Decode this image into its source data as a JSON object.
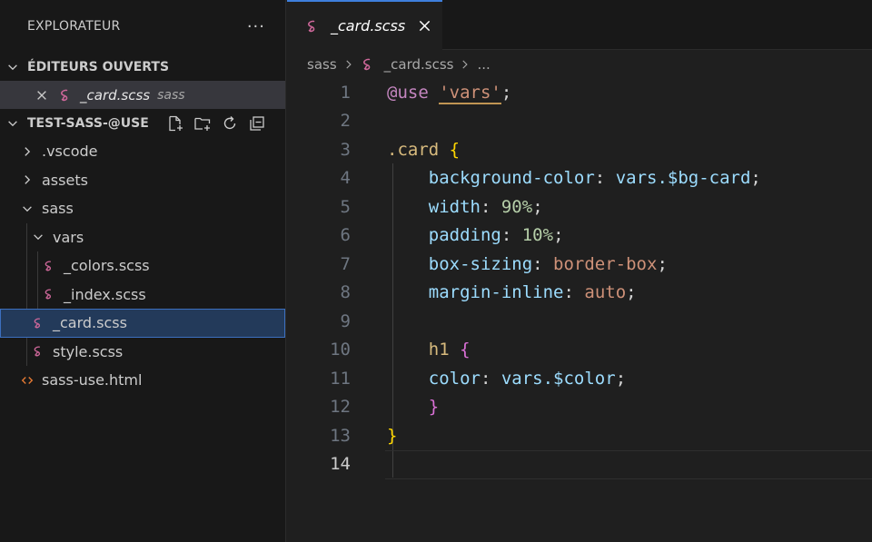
{
  "explorer": {
    "title": "EXPLORATEUR",
    "more": "···"
  },
  "open_editors": {
    "title": "ÉDITEURS OUVERTS",
    "items": [
      {
        "name": "_card.scss",
        "dir": "sass"
      }
    ]
  },
  "workspace": {
    "title": "TEST-SASS-@USE",
    "items": [
      {
        "label": ".vscode",
        "type": "folder",
        "expanded": false
      },
      {
        "label": "assets",
        "type": "folder",
        "expanded": false
      },
      {
        "label": "sass",
        "type": "folder",
        "expanded": true
      },
      {
        "label": "vars",
        "type": "folder",
        "expanded": true
      },
      {
        "label": "_colors.scss",
        "type": "scss"
      },
      {
        "label": "_index.scss",
        "type": "scss"
      },
      {
        "label": "_card.scss",
        "type": "scss",
        "selected": true
      },
      {
        "label": "style.scss",
        "type": "scss"
      },
      {
        "label": "sass-use.html",
        "type": "html"
      }
    ]
  },
  "editor": {
    "tab_label": "_card.scss",
    "breadcrumb": [
      "sass",
      "_card.scss",
      "..."
    ],
    "active_line": "14",
    "line_numbers": [
      "1",
      "2",
      "3",
      "4",
      "5",
      "6",
      "7",
      "8",
      "9",
      "10",
      "11",
      "12",
      "13",
      "14"
    ]
  },
  "code_tokens": {
    "l1_kw": "@use",
    "l1_str": "'vars'",
    "l1_semi": ";",
    "l3_sel": ".card",
    "l3_brace": "{",
    "l4_prop": "background-color",
    "l4_colon": ": ",
    "l4_val": "vars.$bg-card",
    "l4_semi": ";",
    "l5_prop": "width",
    "l5_colon": ": ",
    "l5_val": "90%",
    "l5_semi": ";",
    "l6_prop": "padding",
    "l6_colon": ": ",
    "l6_val": "10%",
    "l6_semi": ";",
    "l7_prop": "box-sizing",
    "l7_colon": ": ",
    "l7_val": "border-box",
    "l7_semi": ";",
    "l8_prop": "margin-inline",
    "l8_colon": ": ",
    "l8_val": "auto",
    "l8_semi": ";",
    "l10_sel": "h1",
    "l10_brace": "{",
    "l11_prop": "color",
    "l11_colon": ": ",
    "l11_val": "vars.$color",
    "l11_semi": ";",
    "l12_brace": "}",
    "l13_brace": "}"
  },
  "colors": {
    "accent": "#3e7fdc",
    "scss_icon": "#cd6799",
    "html_icon": "#e37933"
  }
}
